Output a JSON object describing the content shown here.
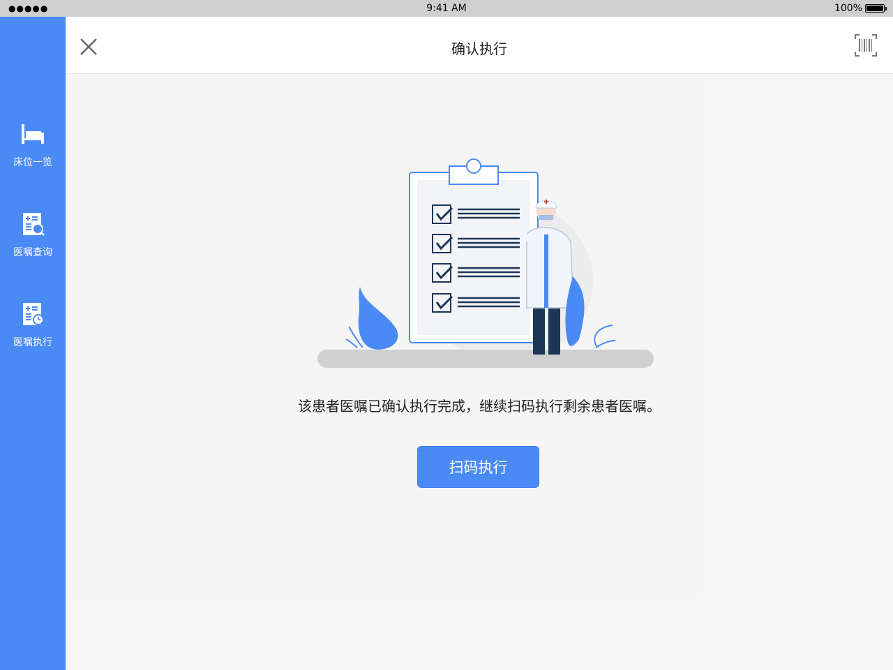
{
  "status_bar": {
    "time": "9:41 AM",
    "battery": "100%",
    "signal": "●●●●●"
  },
  "header": {
    "title": "确认执行",
    "close_icon": "close-icon",
    "scan_icon": "barcode-icon"
  },
  "sidebar": {
    "items": [
      {
        "label": "床位一览",
        "icon": "bed-icon"
      },
      {
        "label": "医嘱查询",
        "icon": "order-search-icon"
      },
      {
        "label": "医嘱执行",
        "icon": "order-execute-icon"
      }
    ]
  },
  "main": {
    "message": "该患者医嘱已确认执行完成，继续扫码执行剩余患者医嘱。",
    "primary_button": "扫码执行"
  },
  "colors": {
    "accent": "#4a8af4",
    "navy": "#1d3557"
  }
}
